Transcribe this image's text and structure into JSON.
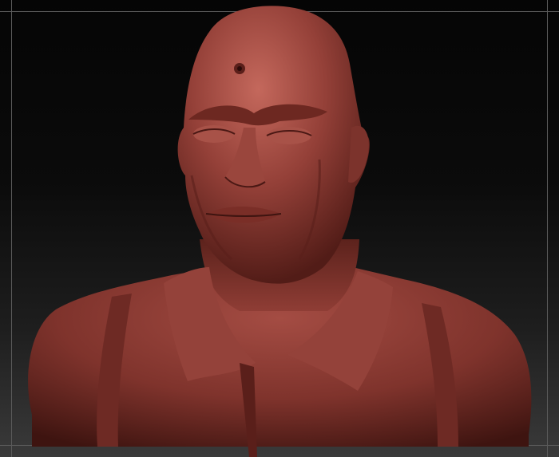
{
  "scene": {
    "subject": "sculpted-bust",
    "material_color": "#8a3a32",
    "background_top": "#050505",
    "background_bottom": "#3a3a3a",
    "frame_color": "#5a5a5a"
  }
}
